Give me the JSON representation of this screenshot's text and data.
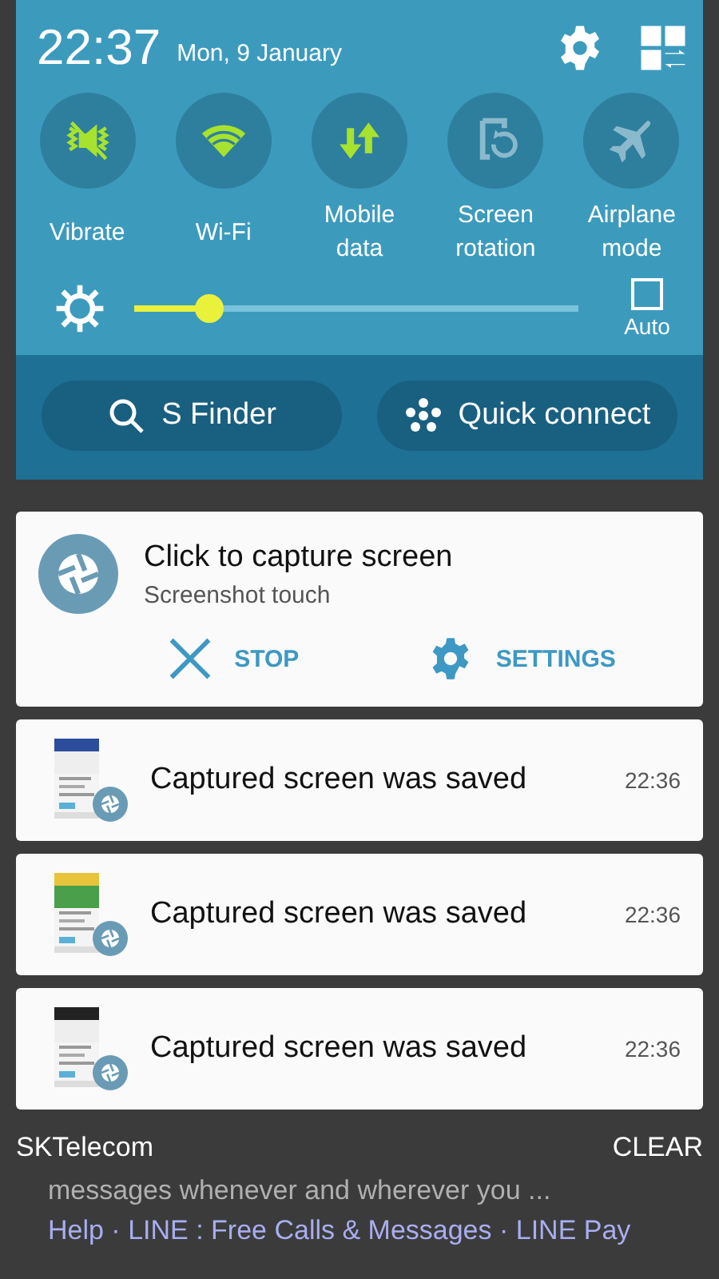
{
  "header": {
    "time": "22:37",
    "date": "Mon, 9 January"
  },
  "toggles": [
    {
      "kind": "vibrate",
      "label": "Vibrate",
      "on": true
    },
    {
      "kind": "wifi",
      "label": "Wi-Fi",
      "on": true
    },
    {
      "kind": "data",
      "label": "Mobile data",
      "on": true
    },
    {
      "kind": "rotation",
      "label": "Screen rotation",
      "on": false
    },
    {
      "kind": "airplane",
      "label": "Airplane mode",
      "on": false
    }
  ],
  "brightness": {
    "level": 0.17,
    "auto": {
      "label": "Auto",
      "checked": false
    }
  },
  "shortcuts": [
    {
      "kind": "search",
      "label": "S Finder"
    },
    {
      "kind": "connect",
      "label": "Quick connect"
    }
  ],
  "capture_notification": {
    "title": "Click to capture screen",
    "subtitle": "Screenshot touch",
    "actions": [
      {
        "kind": "stop",
        "label": "STOP"
      },
      {
        "kind": "settings",
        "label": "SETTINGS"
      }
    ]
  },
  "saved_notifications": [
    {
      "kind": "picture",
      "title": "Captured screen was saved",
      "time": "22:36"
    },
    {
      "kind": "picture",
      "title": "Captured screen was saved",
      "time": "22:36"
    },
    {
      "kind": "picture",
      "title": "Captured screen was saved",
      "time": "22:36"
    }
  ],
  "footer": {
    "carrier": "SKTelecom",
    "clear": "CLEAR"
  },
  "background_page": {
    "lines": [
      "messages whenever and wherever you ...",
      "Help · LINE : Free Calls & Messages · LINE Pay"
    ]
  }
}
